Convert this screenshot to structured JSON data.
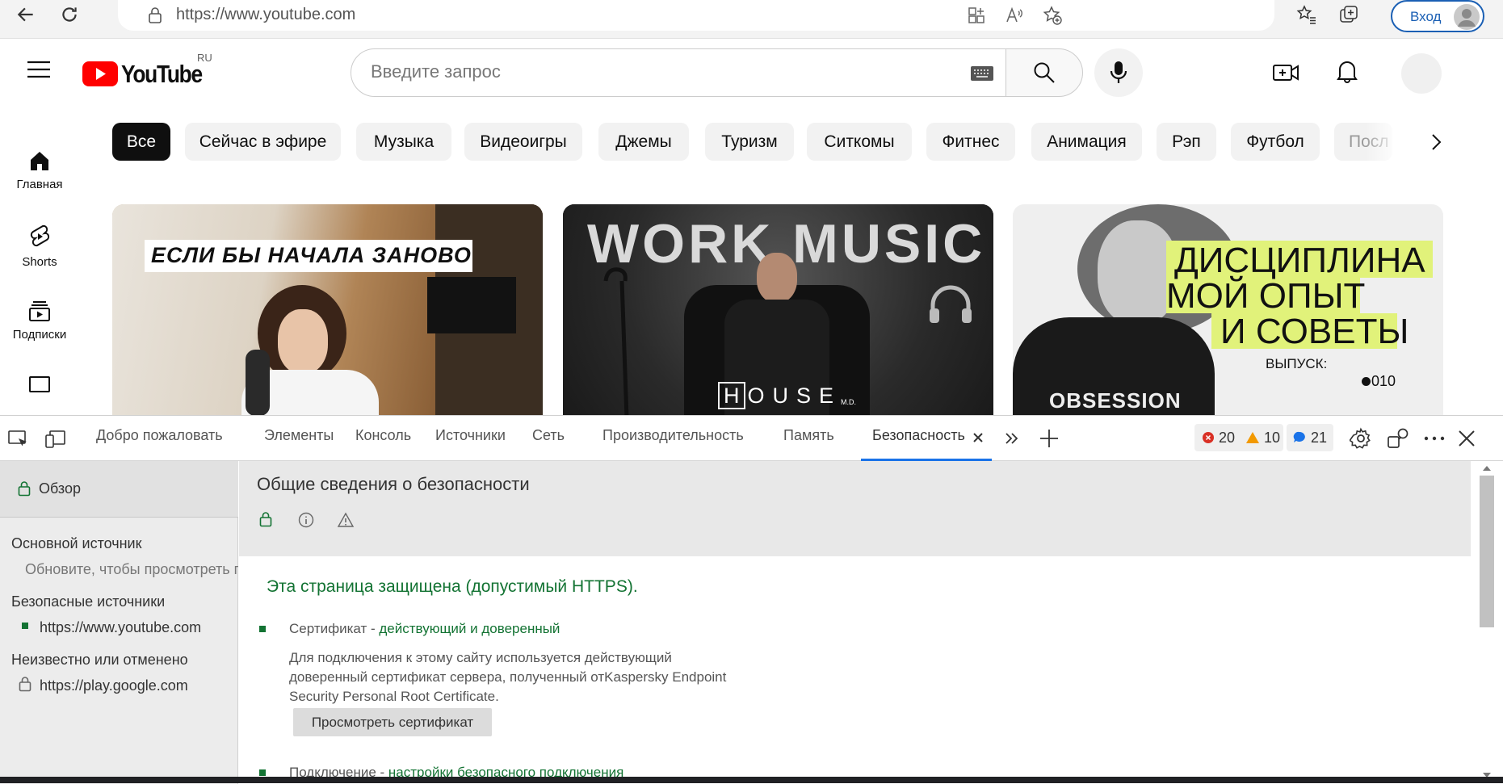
{
  "browser": {
    "url": "https://www.youtube.com",
    "login_label": "Вход"
  },
  "youtube": {
    "logo_text": "YouTube",
    "logo_region": "RU",
    "search_placeholder": "Введите запрос",
    "nav": [
      {
        "label": "Главная",
        "icon": "home-icon"
      },
      {
        "label": "Shorts",
        "icon": "shorts-icon"
      },
      {
        "label": "Подписки",
        "icon": "subscriptions-icon"
      }
    ],
    "chips": [
      "Все",
      "Сейчас в эфире",
      "Музыка",
      "Видеоигры",
      "Джемы",
      "Туризм",
      "Ситкомы",
      "Фитнес",
      "Анимация",
      "Рэп",
      "Футбол",
      "Посл"
    ],
    "thumbnails": {
      "t1": {
        "caption": "ЕСЛИ БЫ НАЧАЛА ЗАНОВО"
      },
      "t2": {
        "title": "WORK MUSIC",
        "brand": "HOUSE",
        "brand_sub": "M.D."
      },
      "t3": {
        "line1": "ДИСЦИПЛИНА",
        "line2": "МОЙ ОПЫТ",
        "line3": "И СОВЕТЫ",
        "issue_label": "ВЫПУСК:",
        "issue_number": "010",
        "shirt_text": "OBSESSION"
      }
    },
    "colors": {
      "brand_red": "#ff0000",
      "chip_active": "#0f0f0f"
    }
  },
  "devtools": {
    "tabs": [
      "Добро пожаловать",
      "Элементы",
      "Консоль",
      "Источники",
      "Сеть",
      "Производительность",
      "Память",
      "Безопасность"
    ],
    "active_tab": "Безопасность",
    "counts": {
      "errors": "20",
      "warnings": "10",
      "info": "21"
    },
    "left_panel": {
      "overview": "Обзор",
      "main_origin_heading": "Основной источник",
      "main_origin_note": "Обновите, чтобы просмотреть г",
      "secure_heading": "Безопасные источники",
      "secure_origin": "https://www.youtube.com",
      "unknown_heading": "Неизвестно или отменено",
      "unknown_origin": "https://play.google.com"
    },
    "main_panel": {
      "title": "Общие сведения о безопасности",
      "status": "Эта страница защищена (допустимый HTTPS).",
      "certificate_label": "Сертификат",
      "certificate_separator": " - ",
      "certificate_status": "действующий и доверенный",
      "certificate_desc_1": "Для подключения к этому сайту используется действующий",
      "certificate_desc_2": "доверенный сертификат сервера, полученный отKaspersky Endpoint",
      "certificate_desc_3": "Security Personal Root Certificate.",
      "view_certificate_button": "Просмотреть сертификат",
      "connection_label": "Подключение",
      "connection_status": "настройки безопасного подключения"
    },
    "colors": {
      "secure_green": "#137333",
      "error_red": "#d93025",
      "warning_yellow": "#f29900",
      "info_blue": "#1a73e8"
    }
  }
}
